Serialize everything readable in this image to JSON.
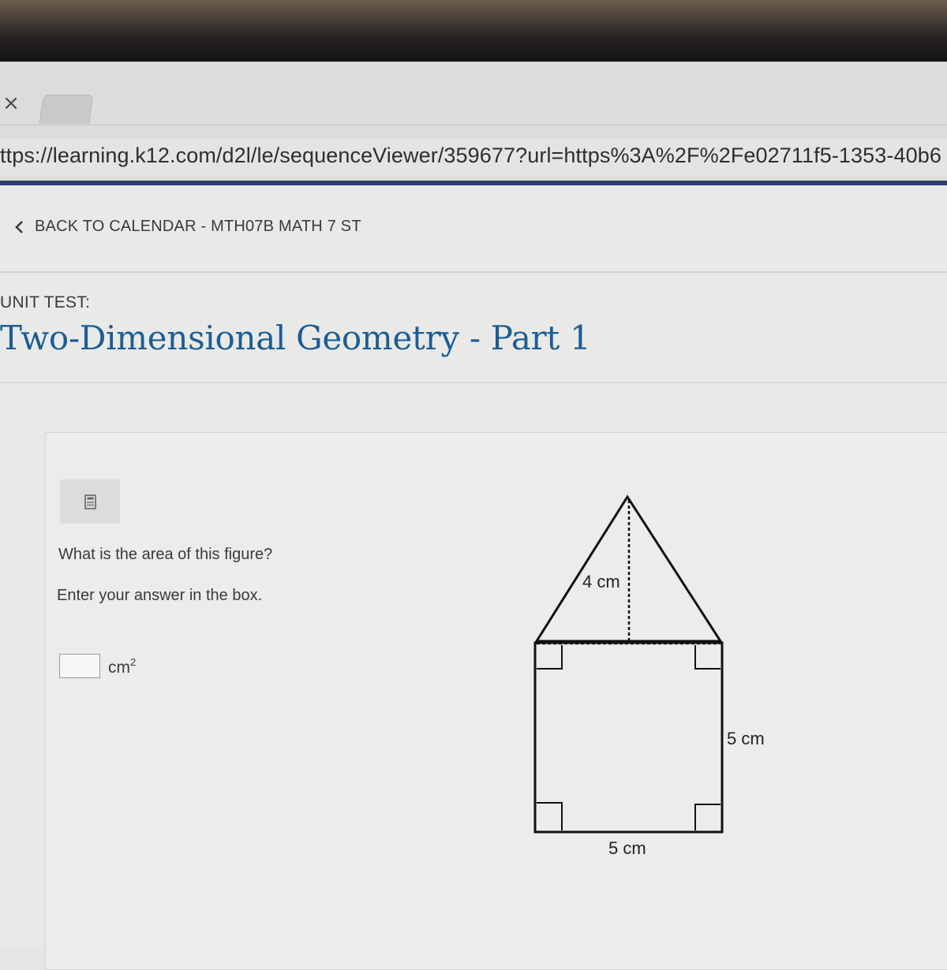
{
  "browser": {
    "tab_close_glyph": "×",
    "url": "ttps://learning.k12.com/d2l/le/sequenceViewer/359677?url=https%3A%2F%2Fe02711f5-1353-40b6"
  },
  "nav": {
    "back_label": "BACK TO CALENDAR - MTH07B MATH 7 ST"
  },
  "header": {
    "eyebrow": "UNIT TEST:",
    "title": "Two-Dimensional Geometry - Part 1"
  },
  "question": {
    "calculator_icon": "calculator-icon",
    "prompt": "What is the area of this figure?",
    "instruction": "Enter your answer in the box.",
    "answer_value": "",
    "unit": "cm",
    "unit_exponent": "2"
  },
  "figure": {
    "height_label": "4 cm",
    "side_label": "5 cm",
    "base_label": "5 cm"
  },
  "colors": {
    "title_blue": "#1c5d94",
    "page_border": "#2b3f6e"
  }
}
